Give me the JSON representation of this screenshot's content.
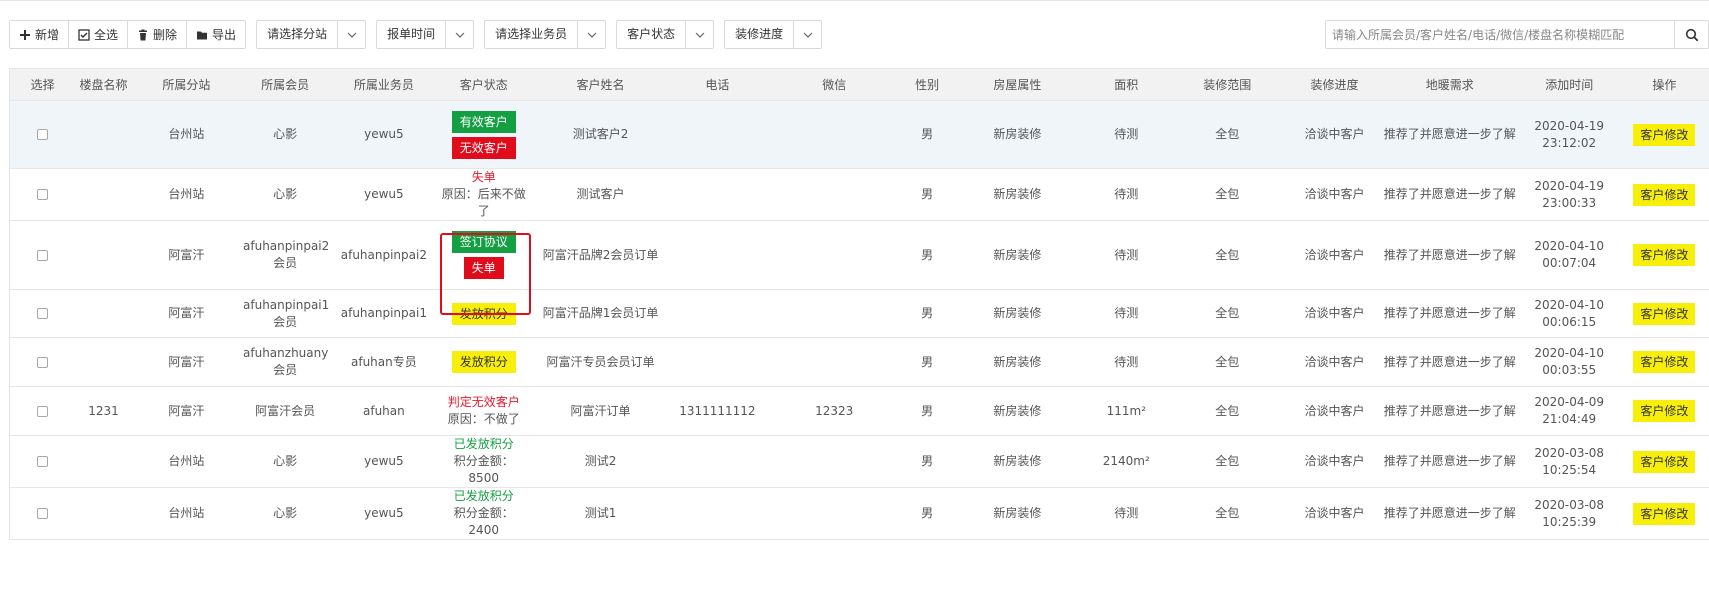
{
  "toolbar": {
    "add": "新增",
    "select_all": "全选",
    "delete": "删除",
    "export": "导出",
    "filters": [
      "请选择分站",
      "报单时间",
      "请选择业务员",
      "客户状态",
      "装修进度"
    ]
  },
  "search": {
    "placeholder": "请输入所属会员/客户姓名/电话/微信/楼盘名称模糊匹配"
  },
  "table": {
    "headers": [
      "选择",
      "楼盘名称",
      "所属分站",
      "所属会员",
      "所属业务员",
      "客户状态",
      "客户姓名",
      "电话",
      "微信",
      "性别",
      "房屋属性",
      "面积",
      "装修范围",
      "装修进度",
      "地暖需求",
      "添加时间",
      "操作"
    ],
    "edit_label": "客户修改",
    "rows": [
      {
        "estate": "",
        "station": "台州站",
        "member": "心影",
        "salesman": "yewu5",
        "status": {
          "tags": [
            {
              "text": "有效客户",
              "color": "green"
            },
            {
              "text": "无效客户",
              "color": "red"
            }
          ]
        },
        "name": "测试客户2",
        "phone": "",
        "wechat": "",
        "gender": "男",
        "house": "新房装修",
        "area": "待测",
        "scope": "全包",
        "progress": "洽谈中客户",
        "heating": "推荐了并愿意进一步了解",
        "date": "2020-04-19",
        "time": "23:12:02"
      },
      {
        "estate": "",
        "station": "台州站",
        "member": "心影",
        "salesman": "yewu5",
        "status": {
          "line1": "失单",
          "line1_color": "red",
          "line2": "原因：后来不做了"
        },
        "name": "测试客户",
        "phone": "",
        "wechat": "",
        "gender": "男",
        "house": "新房装修",
        "area": "待测",
        "scope": "全包",
        "progress": "洽谈中客户",
        "heating": "推荐了并愿意进一步了解",
        "date": "2020-04-19",
        "time": "23:00:33"
      },
      {
        "estate": "",
        "station": "阿富汗",
        "member": "afuhanpinpai2会员",
        "salesman": "afuhanpinpai2",
        "status": {
          "tags": [
            {
              "text": "签订协议",
              "color": "green"
            },
            {
              "text": "失单",
              "color": "red"
            }
          ]
        },
        "name": "阿富汗品牌2会员订单",
        "phone": "",
        "wechat": "",
        "gender": "男",
        "house": "新房装修",
        "area": "待测",
        "scope": "全包",
        "progress": "洽谈中客户",
        "heating": "推荐了并愿意进一步了解",
        "date": "2020-04-10",
        "time": "00:07:04"
      },
      {
        "estate": "",
        "station": "阿富汗",
        "member": "afuhanpinpai1会员",
        "salesman": "afuhanpinpai1",
        "status": {
          "tags": [
            {
              "text": "发放积分",
              "color": "yellow"
            }
          ]
        },
        "name": "阿富汗品牌1会员订单",
        "phone": "",
        "wechat": "",
        "gender": "男",
        "house": "新房装修",
        "area": "待测",
        "scope": "全包",
        "progress": "洽谈中客户",
        "heating": "推荐了并愿意进一步了解",
        "date": "2020-04-10",
        "time": "00:06:15"
      },
      {
        "estate": "",
        "station": "阿富汗",
        "member": "afuhanzhuanyuan会员",
        "salesman": "afuhan专员",
        "status": {
          "tags": [
            {
              "text": "发放积分",
              "color": "yellow"
            }
          ]
        },
        "name": "阿富汗专员会员订单",
        "phone": "",
        "wechat": "",
        "gender": "男",
        "house": "新房装修",
        "area": "待测",
        "scope": "全包",
        "progress": "洽谈中客户",
        "heating": "推荐了并愿意进一步了解",
        "date": "2020-04-10",
        "time": "00:03:55"
      },
      {
        "estate": "1231",
        "station": "阿富汗",
        "member": "阿富汗会员",
        "salesman": "afuhan",
        "status": {
          "line1": "判定无效客户",
          "line1_color": "red",
          "line2": "原因：不做了"
        },
        "name": "阿富汗订单",
        "phone": "1311111112",
        "wechat": "12323",
        "gender": "男",
        "house": "新房装修",
        "area": "111m²",
        "scope": "全包",
        "progress": "洽谈中客户",
        "heating": "推荐了并愿意进一步了解",
        "date": "2020-04-09",
        "time": "21:04:49"
      },
      {
        "estate": "",
        "station": "台州站",
        "member": "心影",
        "salesman": "yewu5",
        "status": {
          "line1": "已发放积分",
          "line1_color": "green",
          "line2": "积分金额：8500"
        },
        "name": "测试2",
        "phone": "",
        "wechat": "",
        "gender": "男",
        "house": "新房装修",
        "area": "2140m²",
        "scope": "全包",
        "progress": "洽谈中客户",
        "heating": "推荐了并愿意进一步了解",
        "date": "2020-03-08",
        "time": "10:25:54"
      },
      {
        "estate": "",
        "station": "台州站",
        "member": "心影",
        "salesman": "yewu5",
        "status": {
          "line1": "已发放积分",
          "line1_color": "green",
          "line2": "积分金额：2400"
        },
        "name": "测试1",
        "phone": "",
        "wechat": "",
        "gender": "男",
        "house": "新房装修",
        "area": "待测",
        "scope": "全包",
        "progress": "洽谈中客户",
        "heating": "推荐了并愿意进一步了解",
        "date": "2020-03-08",
        "time": "10:25:39"
      }
    ]
  }
}
